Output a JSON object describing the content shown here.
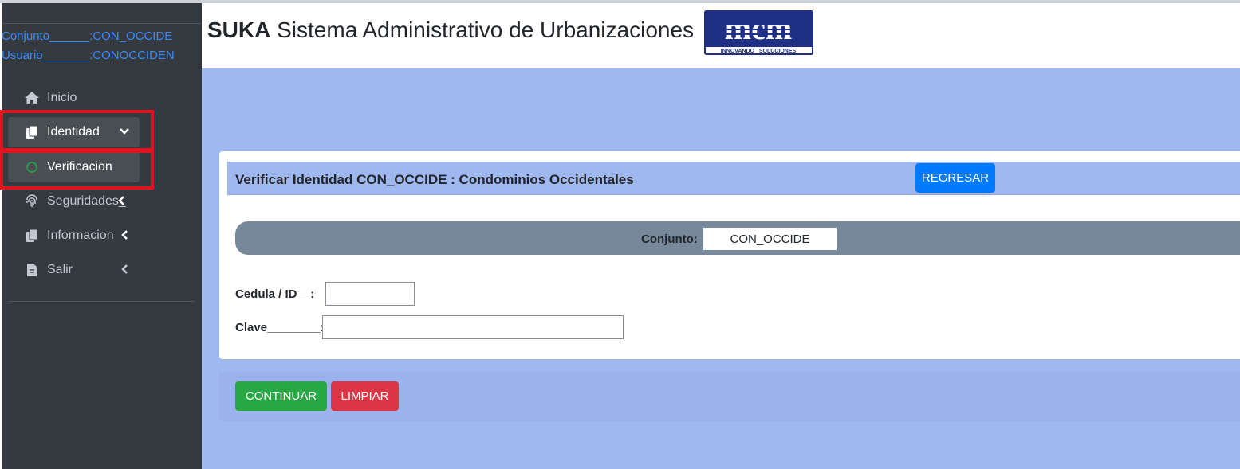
{
  "header": {
    "brand": "SUKA",
    "title": "Sistema Administrativo de Urbanizaciones",
    "logo_text": "mcm",
    "logo_tagline": "INNOVANDO   SOLUCIONES"
  },
  "user_info": {
    "conjunto": "Conjunto______:CON_OCCIDE",
    "usuario": "Usuario_______:CONOCCIDEN"
  },
  "sidebar": {
    "items": [
      {
        "label": "Inicio",
        "icon": "home-icon"
      },
      {
        "label": "Identidad",
        "icon": "copy-icon",
        "caret": "chevron-down-icon"
      },
      {
        "label": "Verificacion",
        "icon": "circle-icon"
      },
      {
        "label": "Seguridades_",
        "icon": "fingerprint-icon",
        "caret": "chevron-left-icon"
      },
      {
        "label": "Informacion",
        "icon": "copy-icon",
        "caret": "chevron-left-icon"
      },
      {
        "label": "Salir",
        "icon": "file-icon",
        "caret": "chevron-left-icon"
      }
    ]
  },
  "card": {
    "title": "Verificar Identidad CON_OCCIDE : Condominios Occidentales",
    "back_button": "REGRESAR",
    "conjunto_label": "Conjunto:",
    "conjunto_value": "CON_OCCIDE",
    "cedula_label": "Cedula / ID__:",
    "cedula_value": "",
    "clave_label": "Clave________:",
    "clave_value": ""
  },
  "actions": {
    "continue": "CONTINUAR",
    "clear": "LIMPIAR"
  },
  "colors": {
    "sidebar_bg": "#343a40",
    "content_bg": "#a0b8f0",
    "highlight": "#e0141e",
    "primary": "#007bff",
    "success": "#28a745",
    "danger": "#dc3545"
  }
}
